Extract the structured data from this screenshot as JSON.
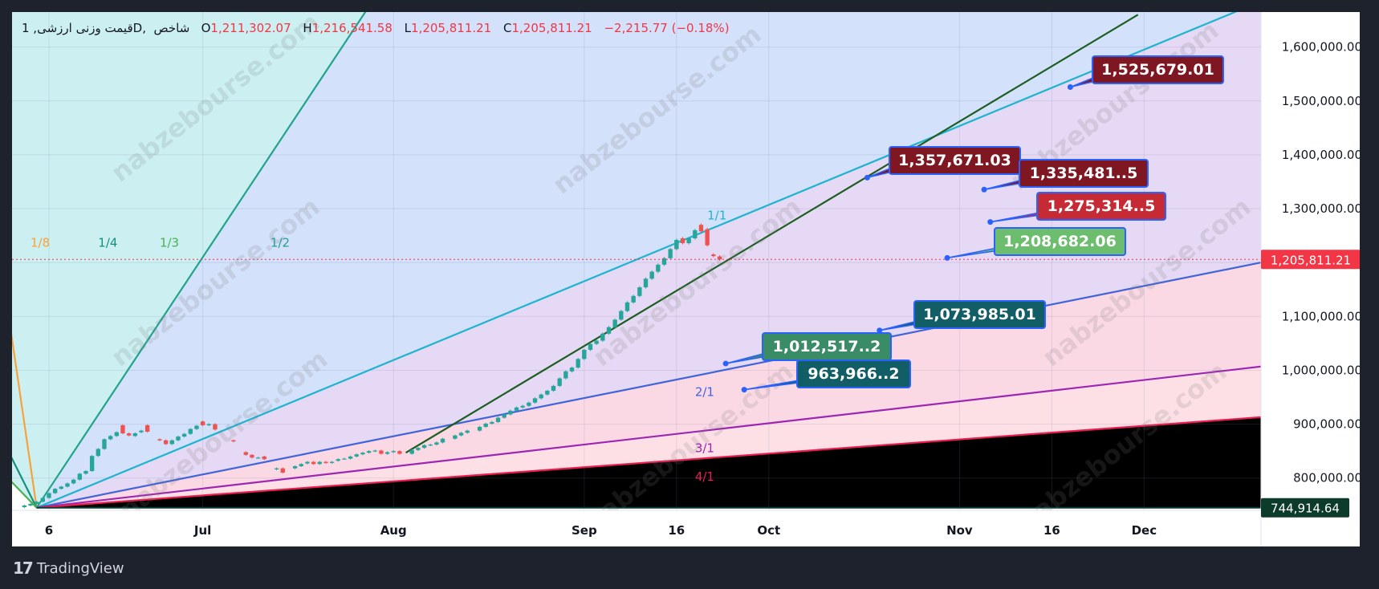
{
  "header": {
    "symbol": "1 ,قیمت وزنی ارزشی",
    "interval": "D",
    "exchange": "شاخص",
    "o_label": "O",
    "o_value": "1,211,302.07",
    "h_label": "H",
    "h_value": "1,216,541.58",
    "l_label": "L",
    "l_value": "1,205,811.21",
    "c_label": "C",
    "c_value": "1,205,811.21",
    "change": "−2,215.77 (−0.18%)"
  },
  "footer": {
    "brand": "TradingView",
    "icon": "tradingview-logo-icon"
  },
  "watermark": "nabzebourse.com",
  "colors": {
    "up": "#26a69a",
    "down": "#ef5350",
    "price_label": "#f23645",
    "bottom_label": "#0c3a2b"
  },
  "chart_data": {
    "type": "candlestick",
    "x_axis": {
      "ticks": [
        "6",
        "Jul",
        "Aug",
        "Sep",
        "16",
        "Oct",
        "Nov",
        "16",
        "Dec"
      ],
      "range": [
        "2024-05-31",
        "2024-12-20"
      ]
    },
    "y_axis": {
      "ticks": [
        "800,000.00",
        "900,000.00",
        "1,000,000.00",
        "1,100,000.00",
        "1,200,000.00",
        "1,300,000.00",
        "1,400,000.00",
        "1,500,000.00",
        "1,600,000.00"
      ],
      "range": [
        740000,
        1665000
      ]
    },
    "current_price": {
      "value": 1205811.21,
      "label": "1,205,811.21"
    },
    "bottom_label": {
      "value": 744914.64,
      "label": "744,914.64"
    },
    "gann_fan": {
      "origin": {
        "date": "2024-06-04",
        "price": 744914.64
      },
      "rays": [
        {
          "label": "1/8",
          "end": {
            "date": "2024-05-31",
            "price": 1058000
          },
          "color": "#f7a23a"
        },
        {
          "label": "1/4",
          "end": {
            "date": "2024-05-31",
            "price": 836000
          },
          "color": "#138f7b"
        },
        {
          "label": "1/3",
          "end": {
            "date": "2024-05-31",
            "price": 792000
          },
          "color": "#4caf50"
        },
        {
          "label": "1/2",
          "end": {
            "date": "2024-07-01",
            "price": 1210000
          },
          "color": "#22a38a"
        },
        {
          "label": "1/1",
          "end": {
            "date": "2024-12-20",
            "price": 1685000
          },
          "color": "#1eb4cf"
        },
        {
          "label": "2/1",
          "end": {
            "date": "2024-12-20",
            "price": 1200000
          },
          "color": "#4165d8"
        },
        {
          "label": "3/1",
          "end": {
            "date": "2024-12-20",
            "price": 1007000
          },
          "color": "#9c27b0"
        },
        {
          "label": "4/1",
          "end": {
            "date": "2024-12-20",
            "price": 913000
          },
          "color": "#e91e4f"
        }
      ],
      "fills": [
        "#fde9d3",
        "#d5efe9",
        "#dcefdc",
        "#ccf0f2",
        "#d3e1fb",
        "#e6d9f5",
        "#fbd9e4",
        "#fde0e6"
      ]
    },
    "trendline": {
      "start": {
        "date": "2024-08-03",
        "price": 847000
      },
      "end": {
        "date": "2024-11-30",
        "price": 1660000
      },
      "color": "#1b5e20"
    },
    "callouts": [
      {
        "label": "1,525,679.01",
        "value": 1525679.01,
        "date": "2024-11-19",
        "color": "#7f1722"
      },
      {
        "label": "1,357,671.03",
        "value": 1357671.03,
        "date": "2024-10-17",
        "color": "#7f1722"
      },
      {
        "label": "1,335,481..5",
        "value": 1335481.5,
        "date": "2024-11-05",
        "color": "#7f1722"
      },
      {
        "label": "1,275,314..5",
        "value": 1275314.5,
        "date": "2024-11-06",
        "color": "#c62a35"
      },
      {
        "label": "1,208,682.06",
        "value": 1208682.06,
        "date": "2024-10-30",
        "color": "#6cbd6e"
      },
      {
        "label": "1,073,985.01",
        "value": 1073985.01,
        "date": "2024-10-19",
        "color": "#125e66"
      },
      {
        "label": "1,012,517..2",
        "value": 1012517.2,
        "date": "2024-09-24",
        "color": "#3a8c66"
      },
      {
        "label": "963,966..2",
        "value": 963966.2,
        "date": "2024-09-27",
        "color": "#125e66"
      }
    ],
    "candles": [
      {
        "date": "2024-06-02",
        "open": 746000,
        "close": 749000
      },
      {
        "date": "2024-06-03",
        "open": 749000,
        "close": 752000
      },
      {
        "date": "2024-06-04",
        "open": 752000,
        "close": 756000
      },
      {
        "date": "2024-06-05",
        "open": 756000,
        "close": 763000
      },
      {
        "date": "2024-06-06",
        "open": 763000,
        "close": 772000
      },
      {
        "date": "2024-06-07",
        "open": 772000,
        "close": 780000
      },
      {
        "date": "2024-06-08",
        "open": 780000,
        "close": 784000
      },
      {
        "date": "2024-06-09",
        "open": 784000,
        "close": 790000
      },
      {
        "date": "2024-06-10",
        "open": 790000,
        "close": 797000
      },
      {
        "date": "2024-06-11",
        "open": 797000,
        "close": 808000
      },
      {
        "date": "2024-06-12",
        "open": 808000,
        "close": 813000
      },
      {
        "date": "2024-06-13",
        "open": 813000,
        "close": 841000
      },
      {
        "date": "2024-06-14",
        "open": 841000,
        "close": 854000
      },
      {
        "date": "2024-06-15",
        "open": 854000,
        "close": 872000
      },
      {
        "date": "2024-06-16",
        "open": 872000,
        "close": 878000
      },
      {
        "date": "2024-06-17",
        "open": 878000,
        "close": 885000
      },
      {
        "date": "2024-06-18",
        "open": 898000,
        "close": 883000
      },
      {
        "date": "2024-06-19",
        "open": 883000,
        "close": 879000
      },
      {
        "date": "2024-06-20",
        "open": 878000,
        "close": 883000
      },
      {
        "date": "2024-06-21",
        "open": 885000,
        "close": 888000
      },
      {
        "date": "2024-06-22",
        "open": 898000,
        "close": 886000
      },
      {
        "date": "2024-06-24",
        "open": 872000,
        "close": 870000
      },
      {
        "date": "2024-06-25",
        "open": 870000,
        "close": 863000
      },
      {
        "date": "2024-06-26",
        "open": 863000,
        "close": 870000
      },
      {
        "date": "2024-06-27",
        "open": 870000,
        "close": 877000
      },
      {
        "date": "2024-06-28",
        "open": 877000,
        "close": 882000
      },
      {
        "date": "2024-06-29",
        "open": 882000,
        "close": 891000
      },
      {
        "date": "2024-06-30",
        "open": 891000,
        "close": 897000
      },
      {
        "date": "2024-07-01",
        "open": 905000,
        "close": 898000
      },
      {
        "date": "2024-07-02",
        "open": 898000,
        "close": 900000
      },
      {
        "date": "2024-07-03",
        "open": 900000,
        "close": 890000
      },
      {
        "date": "2024-07-06",
        "open": 870000,
        "close": 868000
      },
      {
        "date": "2024-07-08",
        "open": 848000,
        "close": 843000
      },
      {
        "date": "2024-07-09",
        "open": 843000,
        "close": 838000
      },
      {
        "date": "2024-07-10",
        "open": 838000,
        "close": 838000
      },
      {
        "date": "2024-07-11",
        "open": 840000,
        "close": 835000
      },
      {
        "date": "2024-07-13",
        "open": 816000,
        "close": 818000
      },
      {
        "date": "2024-07-14",
        "open": 818000,
        "close": 810000
      },
      {
        "date": "2024-07-16",
        "open": 818000,
        "close": 822000
      },
      {
        "date": "2024-07-17",
        "open": 822000,
        "close": 826000
      },
      {
        "date": "2024-07-18",
        "open": 827000,
        "close": 830000
      },
      {
        "date": "2024-07-19",
        "open": 830000,
        "close": 826000
      },
      {
        "date": "2024-07-20",
        "open": 826000,
        "close": 830000
      },
      {
        "date": "2024-07-21",
        "open": 830000,
        "close": 828000
      },
      {
        "date": "2024-07-22",
        "open": 828000,
        "close": 830000
      },
      {
        "date": "2024-07-23",
        "open": 832000,
        "close": 835000
      },
      {
        "date": "2024-07-24",
        "open": 836000,
        "close": 836000
      },
      {
        "date": "2024-07-25",
        "open": 836000,
        "close": 840000
      },
      {
        "date": "2024-07-26",
        "open": 840000,
        "close": 844000
      },
      {
        "date": "2024-07-27",
        "open": 844000,
        "close": 847000
      },
      {
        "date": "2024-07-28",
        "open": 847000,
        "close": 850000
      },
      {
        "date": "2024-07-29",
        "open": 850000,
        "close": 851000
      },
      {
        "date": "2024-07-30",
        "open": 851000,
        "close": 845000
      },
      {
        "date": "2024-07-31",
        "open": 845000,
        "close": 848000
      },
      {
        "date": "2024-08-01",
        "open": 848000,
        "close": 850000
      },
      {
        "date": "2024-08-02",
        "open": 850000,
        "close": 845000
      },
      {
        "date": "2024-08-04",
        "open": 845000,
        "close": 852000
      },
      {
        "date": "2024-08-05",
        "open": 852000,
        "close": 856000
      },
      {
        "date": "2024-08-06",
        "open": 856000,
        "close": 861000
      },
      {
        "date": "2024-08-07",
        "open": 861000,
        "close": 862000
      },
      {
        "date": "2024-08-08",
        "open": 862000,
        "close": 866000
      },
      {
        "date": "2024-08-09",
        "open": 866000,
        "close": 873000
      },
      {
        "date": "2024-08-11",
        "open": 873000,
        "close": 879000
      },
      {
        "date": "2024-08-12",
        "open": 879000,
        "close": 884000
      },
      {
        "date": "2024-08-13",
        "open": 884000,
        "close": 888000
      },
      {
        "date": "2024-08-15",
        "open": 888000,
        "close": 895000
      },
      {
        "date": "2024-08-16",
        "open": 895000,
        "close": 901000
      },
      {
        "date": "2024-08-17",
        "open": 901000,
        "close": 904000
      },
      {
        "date": "2024-08-18",
        "open": 904000,
        "close": 912000
      },
      {
        "date": "2024-08-19",
        "open": 912000,
        "close": 918000
      },
      {
        "date": "2024-08-20",
        "open": 918000,
        "close": 925000
      },
      {
        "date": "2024-08-21",
        "open": 925000,
        "close": 931000
      },
      {
        "date": "2024-08-22",
        "open": 931000,
        "close": 934000
      },
      {
        "date": "2024-08-23",
        "open": 934000,
        "close": 940000
      },
      {
        "date": "2024-08-24",
        "open": 940000,
        "close": 948000
      },
      {
        "date": "2024-08-25",
        "open": 948000,
        "close": 955000
      },
      {
        "date": "2024-08-26",
        "open": 955000,
        "close": 962000
      },
      {
        "date": "2024-08-27",
        "open": 962000,
        "close": 971000
      },
      {
        "date": "2024-08-28",
        "open": 971000,
        "close": 985000
      },
      {
        "date": "2024-08-29",
        "open": 985000,
        "close": 998000
      },
      {
        "date": "2024-08-30",
        "open": 998000,
        "close": 1005000
      },
      {
        "date": "2024-08-31",
        "open": 1005000,
        "close": 1021000
      },
      {
        "date": "2024-09-01",
        "open": 1021000,
        "close": 1038000
      },
      {
        "date": "2024-09-02",
        "open": 1038000,
        "close": 1049000
      },
      {
        "date": "2024-09-03",
        "open": 1049000,
        "close": 1055000
      },
      {
        "date": "2024-09-04",
        "open": 1055000,
        "close": 1068000
      },
      {
        "date": "2024-09-05",
        "open": 1068000,
        "close": 1080000
      },
      {
        "date": "2024-09-06",
        "open": 1080000,
        "close": 1094000
      },
      {
        "date": "2024-09-07",
        "open": 1094000,
        "close": 1110000
      },
      {
        "date": "2024-09-08",
        "open": 1110000,
        "close": 1126000
      },
      {
        "date": "2024-09-09",
        "open": 1126000,
        "close": 1138000
      },
      {
        "date": "2024-09-10",
        "open": 1138000,
        "close": 1154000
      },
      {
        "date": "2024-09-11",
        "open": 1154000,
        "close": 1170000
      },
      {
        "date": "2024-09-12",
        "open": 1170000,
        "close": 1183000
      },
      {
        "date": "2024-09-13",
        "open": 1183000,
        "close": 1196000
      },
      {
        "date": "2024-09-14",
        "open": 1196000,
        "close": 1208000
      },
      {
        "date": "2024-09-15",
        "open": 1208000,
        "close": 1225000
      },
      {
        "date": "2024-09-16",
        "open": 1225000,
        "close": 1242000
      },
      {
        "date": "2024-09-17",
        "open": 1245000,
        "close": 1236000
      },
      {
        "date": "2024-09-18",
        "open": 1236000,
        "close": 1245000
      },
      {
        "date": "2024-09-19",
        "open": 1245000,
        "close": 1260000
      },
      {
        "date": "2024-09-20",
        "open": 1270000,
        "close": 1258000
      },
      {
        "date": "2024-09-21",
        "open": 1262000,
        "close": 1232000
      },
      {
        "date": "2024-09-22",
        "open": 1215000,
        "close": 1212000
      },
      {
        "date": "2024-09-23",
        "open": 1211302.07,
        "close": 1205811.21
      }
    ]
  }
}
